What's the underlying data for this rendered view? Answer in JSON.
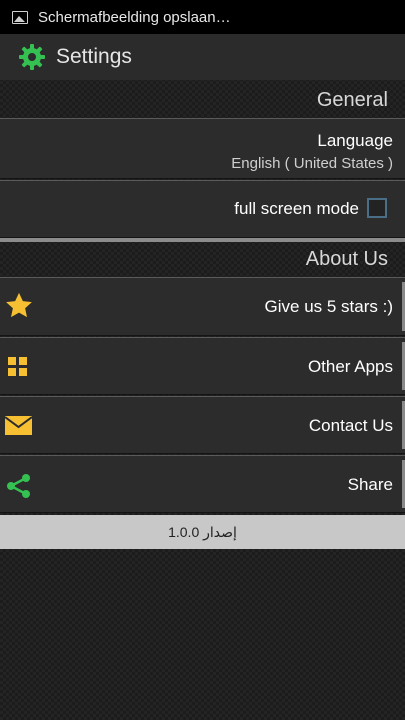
{
  "statusbar": {
    "notification_icon": "image-icon",
    "text": "Schermafbeelding opslaan…"
  },
  "actionbar": {
    "icon": "gear-icon",
    "title": "Settings"
  },
  "general": {
    "header": "General",
    "language_title": "Language",
    "language_value": "English ( United States )",
    "fullscreen_label": "full screen mode",
    "fullscreen_checked": false
  },
  "about": {
    "header": "About Us",
    "items": [
      {
        "label": "Give us 5 stars :)",
        "icon": "star-icon"
      },
      {
        "label": "Other Apps",
        "icon": "grid-icon"
      },
      {
        "label": "Contact Us",
        "icon": "envelope-icon"
      },
      {
        "label": "Share",
        "icon": "share-icon"
      }
    ]
  },
  "version": {
    "text": "إصدار 1.0.0"
  },
  "colors": {
    "accent_green": "#35c152",
    "star_yellow": "#f6c032",
    "version_bar": "#c8c8c8"
  }
}
